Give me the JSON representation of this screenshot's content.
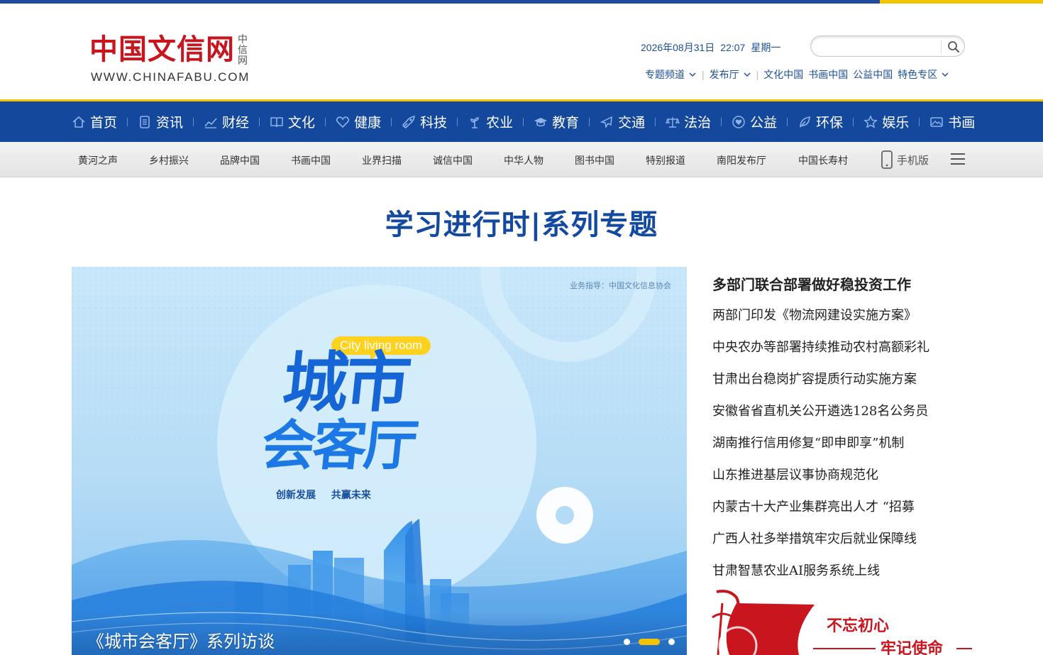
{
  "header": {
    "logo_cn": "中国文信网",
    "logo_vertical": "中信网",
    "logo_url": "WWW.CHINAFABU.COM",
    "date": "2026年08月31日",
    "time": "22:07",
    "weekday": "星期一",
    "search_placeholder": "",
    "links": {
      "special_channel": "专题频道",
      "press_release": "发布厅",
      "culture_china": "文化中国",
      "painting_china": "书画中国",
      "charity_china": "公益中国",
      "featured_zone": "特色专区"
    }
  },
  "main_nav": [
    {
      "label": "首页",
      "icon": "home-icon"
    },
    {
      "label": "资讯",
      "icon": "news-icon"
    },
    {
      "label": "财经",
      "icon": "chart-icon"
    },
    {
      "label": "文化",
      "icon": "book-icon"
    },
    {
      "label": "健康",
      "icon": "heart-icon"
    },
    {
      "label": "科技",
      "icon": "rocket-icon"
    },
    {
      "label": "农业",
      "icon": "plant-icon"
    },
    {
      "label": "教育",
      "icon": "graduation-cap-icon"
    },
    {
      "label": "交通",
      "icon": "plane-icon"
    },
    {
      "label": "法治",
      "icon": "scales-icon"
    },
    {
      "label": "公益",
      "icon": "charity-heart-icon"
    },
    {
      "label": "环保",
      "icon": "leaf-icon"
    },
    {
      "label": "娱乐",
      "icon": "star-icon"
    },
    {
      "label": "书画",
      "icon": "picture-icon"
    }
  ],
  "sub_nav": [
    "黄河之声",
    "乡村振兴",
    "品牌中国",
    "书画中国",
    "业界扫描",
    "诚信中国",
    "中华人物",
    "图书中国",
    "特别报道",
    "南阳发布厅",
    "中国长寿村"
  ],
  "mobile_label": "手机版",
  "topic_title": "学习进行时|系列专题",
  "banner": {
    "guide": "业务指导：中国文化信息协会",
    "tag": "City living room",
    "title_line1": "城市",
    "title_line2": "会客厅",
    "slogan": "创新发展 共赢未来",
    "caption": "《城市会客厅》系列访谈",
    "slide_count": 3,
    "active_slide": 2
  },
  "news": {
    "headline": "多部门联合部署做好稳投资工作",
    "items": [
      "两部门印发《物流网建设实施方案》",
      "中央农办等部署持续推动农村高额彩礼",
      "甘肃出台稳岗扩容提质行动实施方案",
      "安徽省省直机关公开遴选128名公务员",
      "湖南推行信用修复“即申即享”机制",
      "山东推进基层议事协商规范化",
      "内蒙古十大产业集群亮出人才 “招募",
      "广西人社多举措筑牢灾后就业保障线",
      "甘肃智慧农业AI服务系统上线"
    ]
  },
  "promo": {
    "line1": "不忘初心",
    "line2": "牢记使命",
    "script_text": "不忘初心 牢记使命"
  },
  "colors": {
    "brand_red": "#c9151e",
    "nav_blue": "#14489c",
    "accent_gold": "#f4c400",
    "link_blue": "#1d4f9a"
  }
}
